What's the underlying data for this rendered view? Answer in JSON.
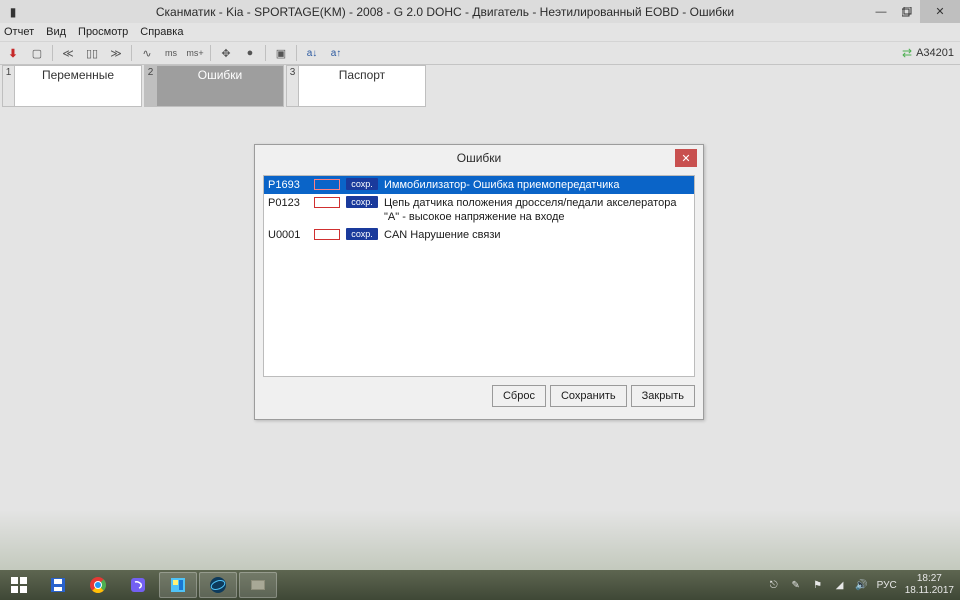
{
  "window": {
    "title": "Сканматик - Kia - SPORTAGE(KM) - 2008 - G 2.0 DOHC - Двигатель - Неэтилированный EOBD - Ошибки"
  },
  "menu": {
    "items": [
      "Отчет",
      "Вид",
      "Просмотр",
      "Справка"
    ]
  },
  "toolbar": {
    "connection": "A34201"
  },
  "tabs": [
    {
      "num": "1",
      "label": "Переменные",
      "active": false
    },
    {
      "num": "2",
      "label": "Ошибки",
      "active": true
    },
    {
      "num": "3",
      "label": "Паспорт",
      "active": false
    }
  ],
  "dialog": {
    "title": "Ошибки",
    "errors": [
      {
        "code": "P1693",
        "status": "сохр.",
        "desc": "Иммобилизатор- Ошибка приемопередатчика",
        "selected": true
      },
      {
        "code": "P0123",
        "status": "сохр.",
        "desc": "Цепь датчика положения дросселя/педали акселератора \"A\" - высокое напряжение на входе",
        "selected": false
      },
      {
        "code": "U0001",
        "status": "сохр.",
        "desc": "CAN Нарушение связи",
        "selected": false
      }
    ],
    "buttons": {
      "reset": "Сброс",
      "save": "Сохранить",
      "close": "Закрыть"
    }
  },
  "tray": {
    "lang": "РУС",
    "time": "18:27",
    "date": "18.11.2017"
  }
}
